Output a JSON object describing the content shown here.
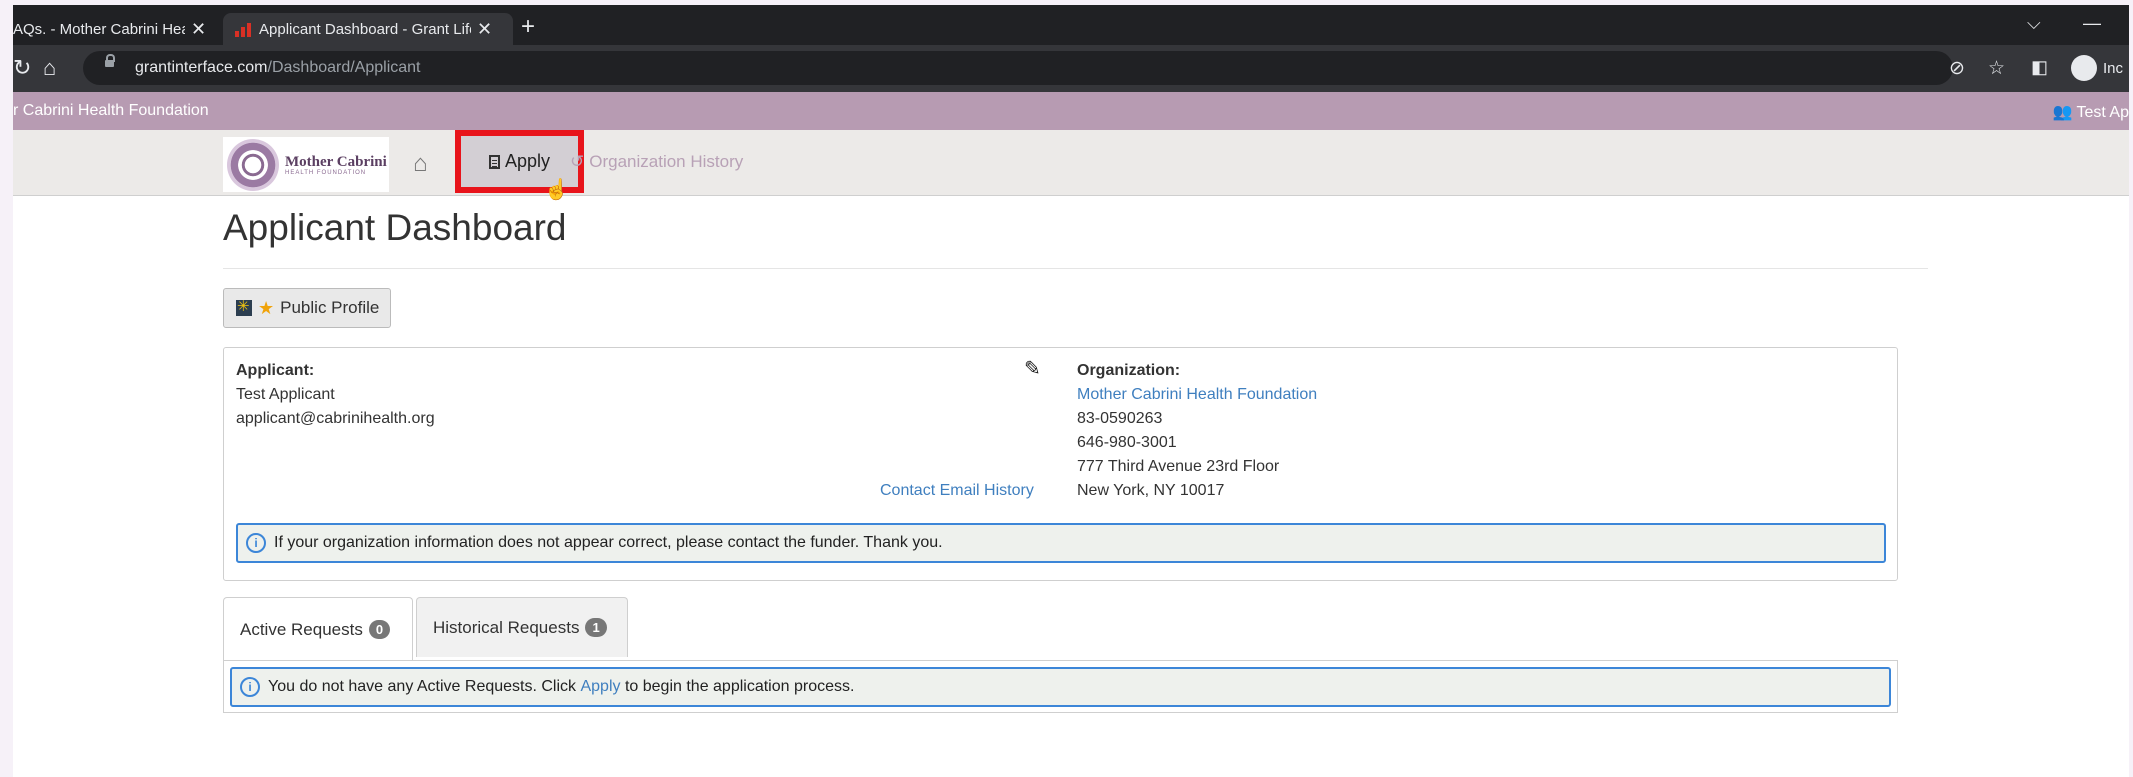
{
  "browser": {
    "tabs": [
      {
        "label": "AQs. - Mother Cabrini Hea",
        "close": "✕"
      },
      {
        "label": "Applicant Dashboard - Grant Life",
        "close": "✕"
      }
    ],
    "new_tab": "+",
    "url_host": "grantinterface.com",
    "url_path": "/Dashboard/Applicant",
    "incognito_label": "Inc"
  },
  "site": {
    "foundation_name": "r Cabrini Health Foundation",
    "user_label": "Test Ap",
    "logo_title": "Mother Cabrini",
    "logo_subtitle": "HEALTH FOUNDATION",
    "nav": {
      "apply": "Apply",
      "organization_history": "Organization History"
    }
  },
  "page": {
    "title": "Applicant Dashboard",
    "public_profile_button": "Public Profile"
  },
  "applicant": {
    "label": "Applicant:",
    "name": "Test Applicant",
    "email": "applicant@cabrinihealth.org",
    "contact_history_link": "Contact Email History"
  },
  "organization": {
    "label": "Organization:",
    "name": "Mother Cabrini Health Foundation",
    "ein": "83-0590263",
    "phone": "646-980-3001",
    "address1": "777 Third Avenue 23rd Floor",
    "address2": "New York, NY 10017",
    "notice": "If your organization information does not appear correct, please contact the funder. Thank you."
  },
  "requests": {
    "tabs": [
      {
        "label": "Active Requests",
        "count": "0"
      },
      {
        "label": "Historical Requests",
        "count": "1"
      }
    ],
    "message_before": "You do not have any Active Requests. Click ",
    "message_link": "Apply",
    "message_after": " to begin the application process."
  },
  "colors": {
    "header_bar": "#b79bb2",
    "highlight_border": "#e8141b",
    "link": "#3f7fbf",
    "alert_border": "#3c86d8"
  }
}
